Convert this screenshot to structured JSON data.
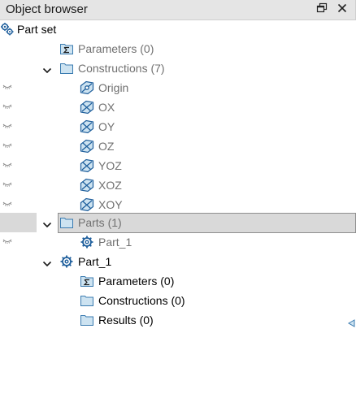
{
  "panel": {
    "title": "Object browser",
    "restore_icon": "restore-window-icon",
    "close_icon": "close-icon"
  },
  "tree": {
    "root": {
      "label": "Part set",
      "icon": "part-set-gears-icon"
    },
    "parameters": {
      "label": "Parameters (0)",
      "icon": "parameters-folder-icon"
    },
    "constructions": {
      "label": "Constructions (7)",
      "icon": "folder-icon",
      "expanded": true,
      "items": [
        {
          "label": "Origin",
          "icon": "construction-point-icon"
        },
        {
          "label": "OX",
          "icon": "construction-axis-icon"
        },
        {
          "label": "OY",
          "icon": "construction-axis-icon"
        },
        {
          "label": "OZ",
          "icon": "construction-axis-icon"
        },
        {
          "label": "YOZ",
          "icon": "construction-plane-icon"
        },
        {
          "label": "XOZ",
          "icon": "construction-plane-icon"
        },
        {
          "label": "XOY",
          "icon": "construction-plane-icon"
        }
      ]
    },
    "parts": {
      "label": "Parts (1)",
      "icon": "folder-icon",
      "expanded": true,
      "selected": true,
      "items": [
        {
          "label": "Part_1",
          "icon": "part-gear-icon"
        }
      ]
    },
    "part_1": {
      "label": "Part_1",
      "icon": "part-gear-icon",
      "expanded": true,
      "children": [
        {
          "label": "Parameters (0)",
          "icon": "parameters-folder-icon"
        },
        {
          "label": "Constructions (0)",
          "icon": "folder-icon"
        },
        {
          "label": "Results (0)",
          "icon": "folder-icon"
        }
      ]
    }
  },
  "colors": {
    "titlebar": "#e5e5e5",
    "selection": "#d9d9d9",
    "folder_fill": "#cde3f1",
    "folder_stroke": "#3a7bb0",
    "dim_text": "#707070"
  }
}
